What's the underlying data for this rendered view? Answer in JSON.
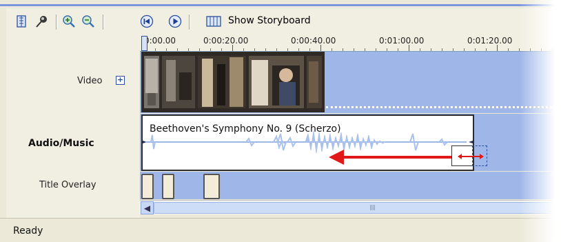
{
  "toolbar": {
    "buttons": [
      {
        "name": "storyboard-view-icon"
      },
      {
        "name": "set-audio-levels-icon"
      },
      {
        "name": "zoom-in-icon"
      },
      {
        "name": "zoom-out-icon"
      },
      {
        "name": "rewind-icon"
      },
      {
        "name": "play-icon"
      }
    ],
    "show_storyboard_label": "Show Storyboard"
  },
  "ruler": {
    "ticks": [
      "0:00.00",
      "0:00:20.00",
      "0:00:40.00",
      "0:01:00.00",
      "0:01:20.00"
    ]
  },
  "tracks": {
    "video_label": "Video",
    "expand_symbol": "+",
    "audio_label": "Audio/Music",
    "title_overlay_label": "Title Overlay"
  },
  "audio_clip": {
    "title": "Beethoven's Symphony No. 9 (Scherzo)"
  },
  "status": {
    "text": "Ready"
  },
  "colors": {
    "track_bg": "#9fb6e9",
    "arrow": "#e01818",
    "toolbar_bg": "#f1efe2"
  }
}
